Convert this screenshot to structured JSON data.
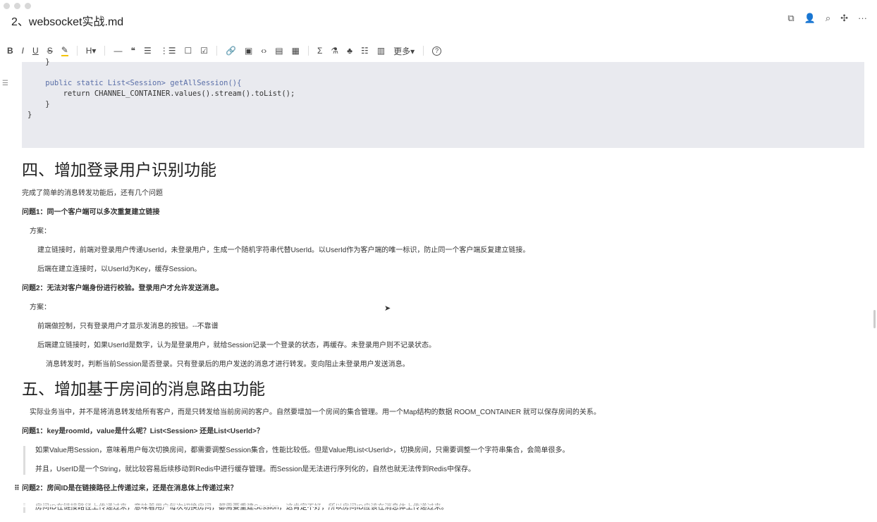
{
  "window": {
    "title": "2、websocket实战.md"
  },
  "top_icons": [
    "source-icon",
    "share-user-icon",
    "search-outline-icon",
    "mindmap-icon",
    "more-icon"
  ],
  "toolbar": {
    "items": [
      "B",
      "I",
      "U",
      "S",
      "✎",
      "H▾",
      "—",
      "❝",
      "☰",
      "⋮☰",
      "☐",
      "☑",
      "🔗",
      "▣",
      "‹›",
      "▤",
      "▦",
      "Σ",
      "⚗",
      "♣",
      "☷",
      "▥"
    ],
    "more": "更多▾",
    "help": "?"
  },
  "code": {
    "lines": [
      "    }",
      "",
      "    public static List<Session> getAllSession(){",
      "        return CHANNEL_CONTAINER.values().stream().toList();",
      "    }",
      "}"
    ]
  },
  "sec4": {
    "heading": "四、增加登录用户识别功能",
    "intro": "完成了简单的消息转发功能后，还有几个问题",
    "q1": "问题1：同一个客户端可以多次重复建立链接",
    "plan1": "方案：",
    "q1a": "建立链接时，前端对登录用户传递UserId，未登录用户，生成一个随机字符串代替UserId。以UserId作为客户端的唯一标识，防止同一个客户端反复建立链接。",
    "q1b": "后端在建立连接时，以UserId为Key，缓存Session。",
    "q2": "问题2：无法对客户端身份进行校验。登录用户才允许发送消息。",
    "plan2": "方案：",
    "q2a": "前端做控制，只有登录用户才显示发消息的按钮。--不靠谱",
    "q2b": "后端建立链接时，如果UserId是数字，认为是登录用户，就给Session记录一个登录的状态，再缓存。未登录用户则不记录状态。",
    "q2c": "消息转发时，判断当前Session是否登录。只有登录后的用户发送的消息才进行转发。变向阻止未登录用户发送消息。"
  },
  "sec5": {
    "heading": "五、增加基于房间的消息路由功能",
    "intro": "实际业务当中，并不是将消息转发给所有客户，而是只转发给当前房间的客户。自然要增加一个房间的集合管理。用一个Map结构的数据 ROOM_CONTAINER 就可以保存房间的关系。",
    "q1": "问题1：key是roomId，value是什么呢？List<Session> 还是List<UserId>？",
    "q1a": "如果Value用Session，意味着用户每次切换房间，都需要调整Session集合，性能比较低。但是Value用List<UserId>，切换房间，只需要调整一个字符串集合，会简单很多。",
    "q1b": "并且，UserID是一个String，就比较容易后续移动到Redis中进行缓存管理。而Session是无法进行序列化的，自然也就无法传到Redis中保存。",
    "q2": "问题2：房间ID是在链接路径上传递过来，还是在消息体上传递过来？",
    "q2a": "房间ID在链接路径上传递过来，意味着用户每次切换房间，都需要重建Session，这肯定不好，所以房间ID应该在消息体上传递过来。"
  }
}
